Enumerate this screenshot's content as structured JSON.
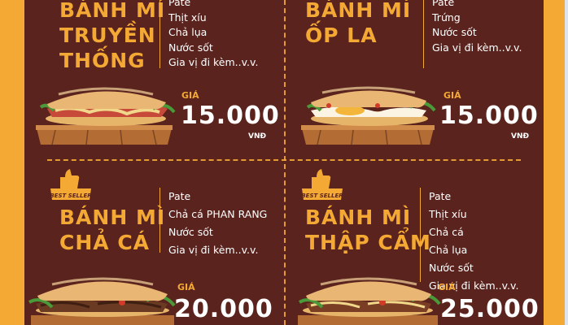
{
  "price_label": "GIÁ",
  "currency": "VNĐ",
  "badge_text": "BEST SELLER",
  "colors": {
    "background": "#5a231d",
    "accent": "#f4a934",
    "text": "#ffffff"
  },
  "items": [
    {
      "title": [
        "BÁNH MÌ",
        "TRUYỀN",
        "THỐNG"
      ],
      "ingredients": [
        "Pate",
        "Thịt xíu",
        "Chả lụa",
        "Nước sốt",
        "Gia vị đi kèm..v.v."
      ],
      "price": "15.000",
      "best_seller": false
    },
    {
      "title": [
        "BÁNH MÌ",
        "ỐP LA"
      ],
      "ingredients": [
        "Pate",
        "Trứng",
        "Nước sốt",
        "Gia vị đi kèm..v.v."
      ],
      "price": "15.000",
      "best_seller": false
    },
    {
      "title": [
        "BÁNH MÌ",
        "CHẢ CÁ"
      ],
      "ingredients": [
        "Pate",
        "Chả cá PHAN RANG",
        "Nước sốt",
        "Gia vị đi kèm..v.v."
      ],
      "price": "20.000",
      "best_seller": true
    },
    {
      "title": [
        "BÁNH MÌ",
        "THẬP CẨM"
      ],
      "ingredients": [
        "Pate",
        "Thịt xíu",
        "Chả cá",
        "Chả lụa",
        "Nước sốt",
        "Gia vị đi kèm..v.v."
      ],
      "price": "25.000",
      "best_seller": true
    }
  ]
}
